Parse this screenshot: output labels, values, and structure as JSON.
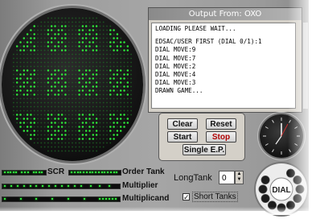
{
  "window": {
    "title": "Output From: OXO"
  },
  "output_lines": [
    "LOADING PLEASE WAIT...",
    "EDSAC/USER FIRST (DIAL 0/1):1",
    "DIAL MOVE:9",
    "DIAL MOVE:7",
    "DIAL MOVE:2",
    "DIAL MOVE:4",
    "DIAL MOVE:3",
    "DRAWN GAME..."
  ],
  "controls": {
    "clear": "Clear",
    "reset": "Reset",
    "start": "Start",
    "stop": "Stop",
    "single_ep": "Single E.P."
  },
  "registers": {
    "scr": "SCR",
    "order_tank": "Order Tank",
    "multiplier": "Multiplier",
    "multiplicand": "Multiplicand"
  },
  "long_tank": {
    "label": "LongTank",
    "value": "0"
  },
  "short_tanks": {
    "label": "Short Tanks",
    "checked": true
  },
  "dial": {
    "label": "DIAL"
  },
  "colors": {
    "phosphor": "#2eea3a",
    "stop_text": "#b10000"
  }
}
